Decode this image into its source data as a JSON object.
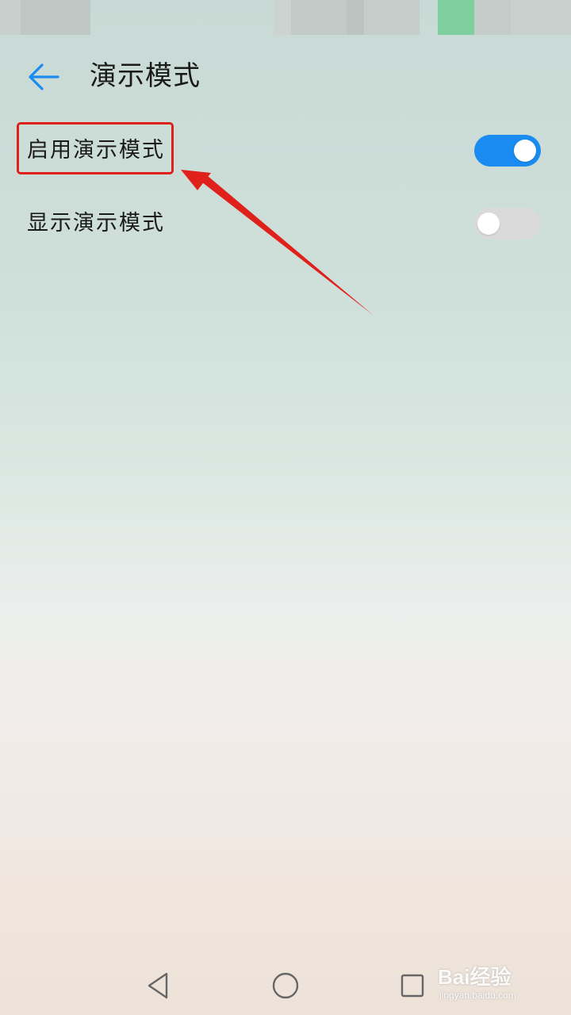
{
  "header": {
    "back_icon": "arrow-left-icon",
    "title": "演示模式"
  },
  "settings": [
    {
      "label": "启用演示模式",
      "enabled": true
    },
    {
      "label": "显示演示模式",
      "enabled": false
    }
  ],
  "nav_bar": {
    "icons": [
      "triangle-back-icon",
      "circle-home-icon",
      "square-recent-icon"
    ]
  },
  "watermark": {
    "main": "Bai经验",
    "sub": "jingyan.baidu.com"
  },
  "colors": {
    "accent": "#1a8bf0",
    "toggle_off": "#dadada",
    "annotation": "#e0201b"
  }
}
